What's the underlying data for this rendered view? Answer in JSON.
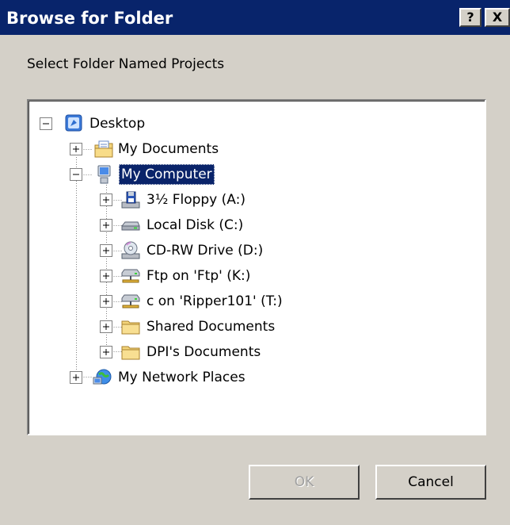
{
  "window": {
    "title": "Browse for Folder",
    "help_glyph": "?",
    "close_glyph": "X"
  },
  "instruction": "Select Folder Named Projects",
  "tree": {
    "root": {
      "label": "Desktop",
      "icon": "desktop-icon",
      "expander": "minus"
    },
    "my_documents": {
      "label": "My Documents",
      "icon": "my-documents-icon",
      "expander": "plus"
    },
    "my_computer": {
      "label": "My Computer",
      "icon": "computer-icon",
      "expander": "minus",
      "selected": true
    },
    "computer_children": [
      {
        "label": "3½ Floppy (A:)",
        "icon": "floppy-drive-icon",
        "expander": "plus"
      },
      {
        "label": "Local Disk (C:)",
        "icon": "hard-disk-icon",
        "expander": "plus"
      },
      {
        "label": "CD-RW Drive (D:)",
        "icon": "cd-drive-icon",
        "expander": "plus"
      },
      {
        "label": "Ftp on 'Ftp' (K:)",
        "icon": "network-drive-icon",
        "expander": "plus"
      },
      {
        "label": "c on 'Ripper101' (T:)",
        "icon": "network-drive-icon",
        "expander": "plus"
      },
      {
        "label": "Shared Documents",
        "icon": "folder-icon",
        "expander": "plus"
      },
      {
        "label": "DPI's Documents",
        "icon": "folder-icon",
        "expander": "plus"
      }
    ],
    "my_network_places": {
      "label": "My Network Places",
      "icon": "network-places-icon",
      "expander": "plus"
    }
  },
  "buttons": {
    "ok_label": "OK",
    "ok_enabled": false,
    "cancel_label": "Cancel"
  },
  "colors": {
    "dialog_face": "#d4d0c8",
    "title_bar": "#08246b",
    "selection": "#0a246a"
  }
}
